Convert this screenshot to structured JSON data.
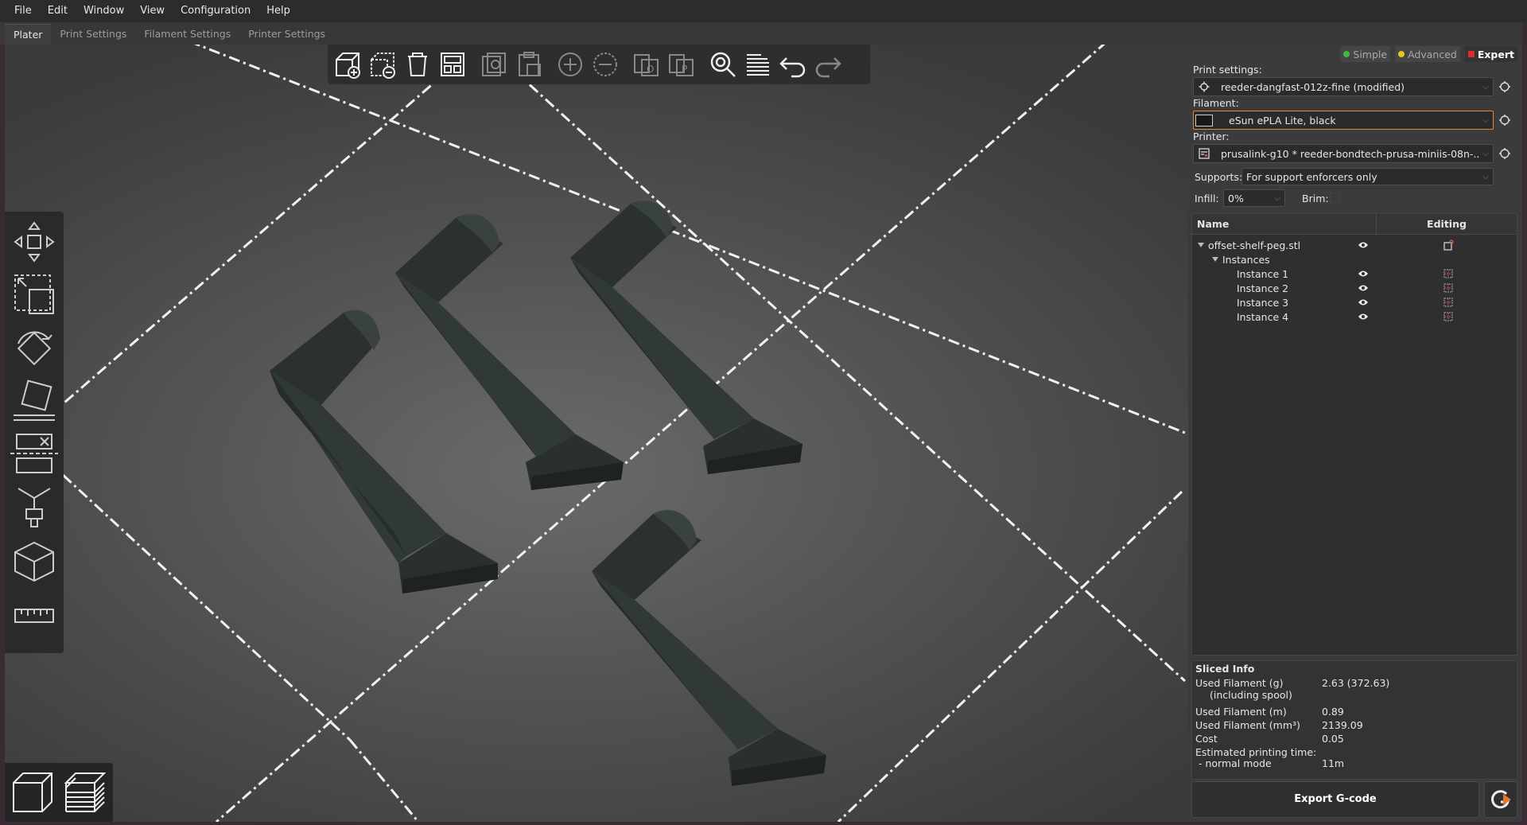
{
  "menubar": {
    "items": [
      "File",
      "Edit",
      "Window",
      "View",
      "Configuration",
      "Help"
    ]
  },
  "tabs": [
    {
      "label": "Plater",
      "active": true
    },
    {
      "label": "Print Settings",
      "active": false
    },
    {
      "label": "Filament Settings",
      "active": false
    },
    {
      "label": "Printer Settings",
      "active": false
    }
  ],
  "modes": {
    "simple": {
      "label": "Simple",
      "color": "#3bbd3b"
    },
    "advanced": {
      "label": "Advanced",
      "color": "#e6c81e"
    },
    "expert": {
      "label": "Expert",
      "color": "#e02b2b"
    }
  },
  "sidebar": {
    "print_settings_label": "Print settings:",
    "print_settings_value": "reeder-dangfast-012z-fine (modified)",
    "filament_label": "Filament:",
    "filament_value": "eSun ePLA Lite, black",
    "filament_color": "#1a1a1a",
    "printer_label": "Printer:",
    "printer_value": "prusalink-g10 * reeder-bondtech-prusa-miniis-08n-...",
    "supports_label": "Supports:",
    "supports_value": "For support enforcers only",
    "infill_label": "Infill:",
    "infill_value": "0%",
    "brim_label": "Brim:"
  },
  "object_list": {
    "col_name": "Name",
    "col_editing": "Editing",
    "object_name": "offset-shelf-peg.stl",
    "instances_label": "Instances",
    "instances": [
      "Instance 1",
      "Instance 2",
      "Instance 3",
      "Instance 4"
    ]
  },
  "sliced_info": {
    "title": "Sliced Info",
    "rows": [
      {
        "key": "Used Filament (g)",
        "value": "2.63 (372.63)"
      },
      {
        "key": "(including spool)",
        "value": ""
      },
      {
        "key": "Used Filament (m)",
        "value": "0.89"
      },
      {
        "key": "Used Filament (mm³)",
        "value": "2139.09"
      },
      {
        "key": "Cost",
        "value": "0.05"
      },
      {
        "key": "Estimated printing time:",
        "value": ""
      },
      {
        "key": "- normal mode",
        "value": "11m"
      }
    ]
  },
  "export_label": "Export G-code",
  "icons": {
    "top_toolbar": [
      "add-icon",
      "delete-icon",
      "delete-all-icon",
      "arrange-icon",
      "copy-icon",
      "paste-icon",
      "add-instance-icon",
      "remove-instance-icon",
      "split-objects-icon",
      "split-parts-icon",
      "search-icon",
      "layers-editing-icon",
      "undo-icon",
      "redo-icon"
    ],
    "left_toolbar": [
      "move-icon",
      "scale-icon",
      "rotate-icon",
      "place-on-face-icon",
      "cut-icon",
      "support-paint-icon",
      "seam-paint-icon",
      "measure-icon"
    ]
  }
}
